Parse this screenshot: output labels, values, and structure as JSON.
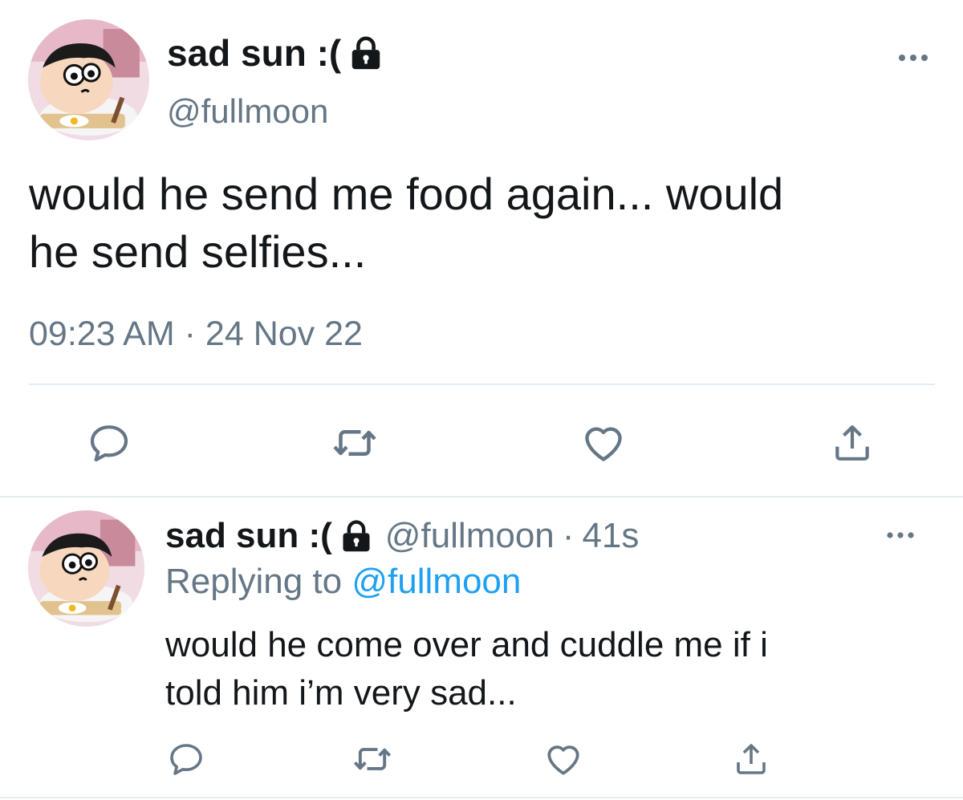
{
  "colors": {
    "text_primary": "#14171a",
    "text_secondary": "#657786",
    "link": "#1da1f2",
    "divider": "#e6ecf0",
    "icon": "#657786"
  },
  "main_tweet": {
    "display_name": "sad sun :(",
    "handle": "@fullmoon",
    "text": "would he send me food again... would\nhe send selfies...",
    "time": "09:23 AM",
    "separator": "·",
    "date": "24 Nov 22",
    "icons": {
      "avatar": "cartoon-boy-avatar",
      "protected": "lock-icon",
      "more": "more-dots-icon",
      "reply": "reply-bubble-icon",
      "retweet": "retweet-icon",
      "like": "heart-icon",
      "share": "share-icon"
    }
  },
  "reply_tweet": {
    "display_name": "sad sun :(",
    "handle": "@fullmoon",
    "separator": "·",
    "time_ago": "41s",
    "replying_prefix": "Replying to",
    "replying_mention": "@fullmoon",
    "text": "would he come over and cuddle me if i\ntold him i’m very sad..."
  }
}
